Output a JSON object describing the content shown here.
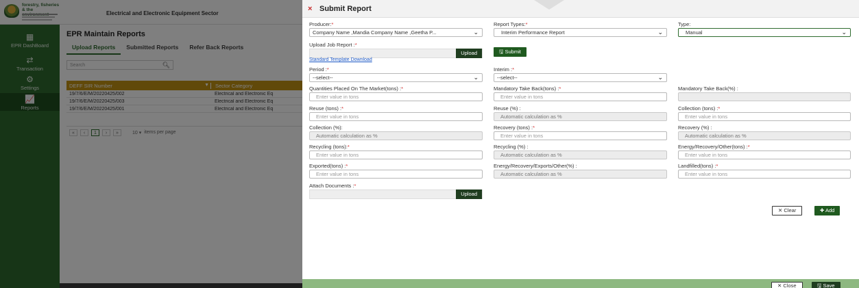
{
  "app": {
    "logo_lines": [
      "forestry, fisheries",
      "& the environment"
    ],
    "sector_title": "Electrical and Electronic Equipment Sector"
  },
  "sidebar": {
    "items": [
      {
        "label": "EPR DashBoard",
        "icon": "grid-icon"
      },
      {
        "label": "Transaction",
        "icon": "arrows-icon"
      },
      {
        "label": "Settings",
        "icon": "gears-icon"
      },
      {
        "label": "Reports",
        "icon": "chart-icon"
      }
    ]
  },
  "page": {
    "title": "EPR Maintain Reports",
    "tabs": [
      "Upload Reports",
      "Submitted Reports",
      "Refer Back Reports"
    ],
    "search_placeholder": "Search",
    "table": {
      "headers": [
        "DEFF SIR Number",
        "Sector Category"
      ],
      "rows": [
        [
          "19/7/6/E/M/20220425/002",
          "Electrical and Electronic Eq"
        ],
        [
          "19/7/6/E/M/20220425/003",
          "Electrical and Electronic Eq"
        ],
        [
          "19/7/6/E/M/20220425/001",
          "Electrical and Electronic Eq"
        ]
      ]
    },
    "pager": {
      "first": "«",
      "prev": "‹",
      "current": "1",
      "next": "›",
      "last": "»",
      "page_size": "10",
      "items_per_page": "items per page"
    }
  },
  "modal": {
    "title": "Submit Report",
    "close_glyph": "×",
    "producer": {
      "label": "Producer:",
      "value": "Company Name ,Mandia Company Name ,Geetha P..."
    },
    "report_types": {
      "label": "Report Types:",
      "value": "Interim Performance Report"
    },
    "type": {
      "label": "Type:",
      "value": "Manual"
    },
    "upload_job_report": {
      "label": "Upload Job Report :",
      "button": "Upload"
    },
    "submit_button": "Submit",
    "template_link": "Standard Template Download",
    "period": {
      "label": "Period :",
      "value": "--select--"
    },
    "interim": {
      "label": "Interim :",
      "value": "--select--"
    },
    "fields": {
      "qty_placed": {
        "label": "Quantities Placed On The Market(tons) :",
        "placeholder": "Enter value in tons"
      },
      "mand_take_back_tons": {
        "label": "Mandatory Take Back(tons) :",
        "placeholder": "Enter value in tons"
      },
      "mand_take_back_pct": {
        "label": "Mandatory Take Back(%) :",
        "placeholder": ""
      },
      "reuse_tons": {
        "label": "Reuse (tons) :",
        "placeholder": "Enter value in tons"
      },
      "reuse_pct": {
        "label": "Reuse (%) :",
        "placeholder": "Automatic calculation as %"
      },
      "collection_tons": {
        "label": "Collection (tons) :",
        "placeholder": "Enter value in tons"
      },
      "collection_pct": {
        "label": "Collection (%):",
        "placeholder": "Automatic calculation as %"
      },
      "recovery_tons": {
        "label": "Recovery (tons) :",
        "placeholder": "Enter value in tons"
      },
      "recovery_pct": {
        "label": "Recovery (%) :",
        "placeholder": "Automatic calculation as %"
      },
      "recycling_tons": {
        "label": "Recycling (tons):",
        "placeholder": "Enter value in tons"
      },
      "recycling_pct": {
        "label": "Recycling (%) :",
        "placeholder": "Automatic calculation as %"
      },
      "energy_other_tons": {
        "label": "Energy/Recovery/Other(tons) :",
        "placeholder": "Enter value in tons"
      },
      "exported_tons": {
        "label": "Exported(tons) :",
        "placeholder": "Enter value in tons"
      },
      "energy_exports_pct": {
        "label": "Energy/Recovery/Exports/Other(%) :",
        "placeholder": "Automatic calculation as %"
      },
      "landfilled_tons": {
        "label": "Landfilled(tons) :",
        "placeholder": "Enter value in tons"
      }
    },
    "attach_documents": {
      "label": "Attach Documents :",
      "button": "Upload"
    },
    "clear_button": "Clear",
    "add_button": "Add",
    "close_button": "Close",
    "save_button": "Save",
    "required_mark": "*"
  },
  "colors": {
    "brand_green": "#2e6b2e",
    "header_gold": "#c39212",
    "required_red": "#d32f2f",
    "footer_green": "#8db880"
  }
}
